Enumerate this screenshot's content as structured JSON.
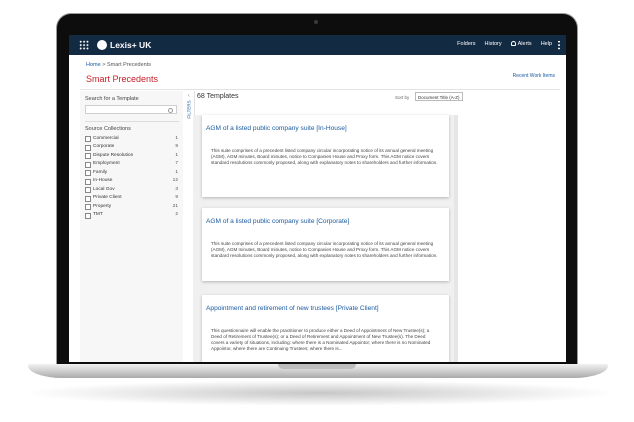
{
  "app": {
    "brand": "Lexis+ UK"
  },
  "nav": {
    "folders": "Folders",
    "history": "History",
    "alerts": "Alerts",
    "help": "Help"
  },
  "breadcrumb": {
    "home": "Home",
    "separator": ">",
    "current": "Smart Precedents"
  },
  "page": {
    "title": "Smart Precedents",
    "recent_link": "Recent Work Items"
  },
  "sidebar": {
    "search_label": "Search for a Template",
    "search_value": "",
    "source_title": "Source Collections",
    "filters_toggle": "FILTERS",
    "items": [
      {
        "label": "Commercial",
        "count": "1"
      },
      {
        "label": "Corporate",
        "count": "9"
      },
      {
        "label": "Dispute Resolution",
        "count": "1"
      },
      {
        "label": "Employment",
        "count": "7"
      },
      {
        "label": "Family",
        "count": "1"
      },
      {
        "label": "In-House",
        "count": "12"
      },
      {
        "label": "Local Gov",
        "count": "3"
      },
      {
        "label": "Private Client",
        "count": "9"
      },
      {
        "label": "Property",
        "count": "21"
      },
      {
        "label": "TMT",
        "count": "2"
      }
    ]
  },
  "results": {
    "count_label": "68 Templates",
    "sort_label": "Sort by",
    "sort_value": "Document Title (A-Z)",
    "cards": [
      {
        "title": "AGM of a listed public company suite  [In-House]",
        "desc": "This suite comprises of a precedent listed company circular incorporating notice of its annual general meeting (AGM), AGM minutes, Board minutes, notice to Companies House and Proxy form. This AGM notice covers standard resolutions commonly proposed, along with explanatory notes to shareholders and further information."
      },
      {
        "title": "AGM of a listed public company suite  [Corporate]",
        "desc": "This suite comprises of a precedent listed company circular incorporating notice of its annual general meeting (AGM), AGM minutes, Board minutes, notice to Companies House and Proxy form. This AGM notice covers standard resolutions commonly proposed, along with explanatory notes to shareholders and further information."
      },
      {
        "title": "Appointment and retirement of new trustees  [Private Client]",
        "desc": "This questionnaire will enable the practitioner to produce either a Deed of Appointment of New Trustee(s); a Deed of Retirement of Trustee(s); or a Deed of Retirement and Appointment of New Trustee(s). The Deed covers a variety of situations, including: where there is a Nominated Appointor; where there is no Nominated Appointor, where there are Continuing Trustees; where there is..."
      }
    ]
  },
  "colors": {
    "topbar": "#132a43",
    "title_red": "#c8202a",
    "link_blue": "#1a5aa0"
  }
}
